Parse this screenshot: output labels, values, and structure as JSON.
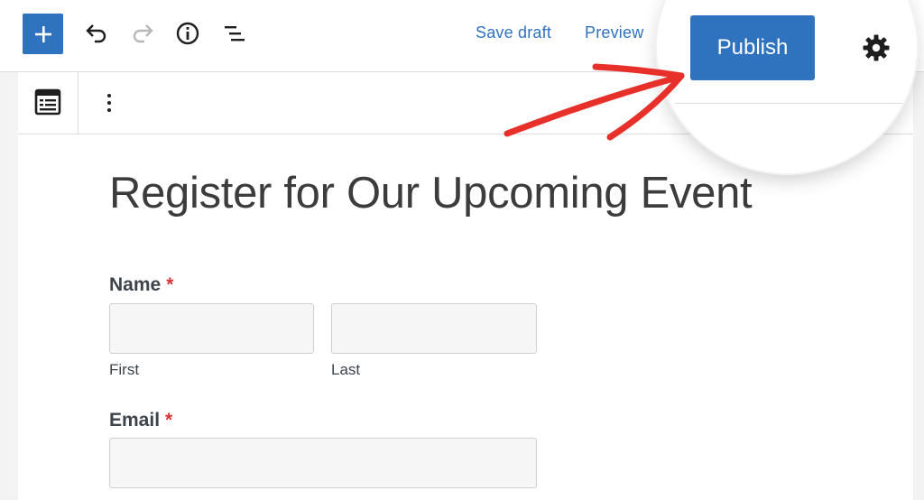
{
  "toolbar": {
    "add_icon": "plus-icon",
    "undo_icon": "undo-icon",
    "redo_icon": "redo-icon",
    "details_icon": "info-icon",
    "list_view_icon": "list-view-icon",
    "save_draft_label": "Save draft",
    "preview_label": "Preview",
    "publish_label": "Publish",
    "settings_icon": "gear-icon"
  },
  "block_toolbar": {
    "block_icon": "form-block-icon",
    "options_icon": "more-vertical-icon"
  },
  "form": {
    "title": "Register for Our Upcoming Event",
    "name_label": "Name",
    "required_mark": "*",
    "first_sublabel": "First",
    "last_sublabel": "Last",
    "email_label": "Email"
  },
  "colors": {
    "accent": "#2f72bd",
    "required": "#d63638",
    "annotation_arrow": "#e8302b"
  }
}
